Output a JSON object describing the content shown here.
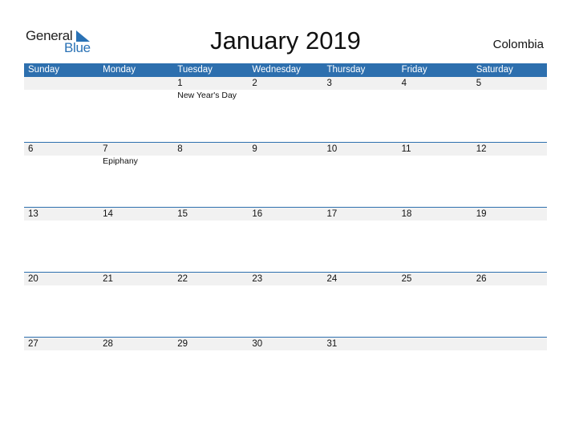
{
  "logo": {
    "line1": "General",
    "line2": "Blue"
  },
  "title": "January 2019",
  "country": "Colombia",
  "colors": {
    "header_bg": "#2d6fae",
    "logo_blue": "#2a72b5",
    "band": "#f1f1f1"
  },
  "days": [
    "Sunday",
    "Monday",
    "Tuesday",
    "Wednesday",
    "Thursday",
    "Friday",
    "Saturday"
  ],
  "weeks": [
    [
      {
        "d": "",
        "h": ""
      },
      {
        "d": "",
        "h": ""
      },
      {
        "d": "1",
        "h": "New Year's Day"
      },
      {
        "d": "2",
        "h": ""
      },
      {
        "d": "3",
        "h": ""
      },
      {
        "d": "4",
        "h": ""
      },
      {
        "d": "5",
        "h": ""
      }
    ],
    [
      {
        "d": "6",
        "h": ""
      },
      {
        "d": "7",
        "h": "Epiphany"
      },
      {
        "d": "8",
        "h": ""
      },
      {
        "d": "9",
        "h": ""
      },
      {
        "d": "10",
        "h": ""
      },
      {
        "d": "11",
        "h": ""
      },
      {
        "d": "12",
        "h": ""
      }
    ],
    [
      {
        "d": "13",
        "h": ""
      },
      {
        "d": "14",
        "h": ""
      },
      {
        "d": "15",
        "h": ""
      },
      {
        "d": "16",
        "h": ""
      },
      {
        "d": "17",
        "h": ""
      },
      {
        "d": "18",
        "h": ""
      },
      {
        "d": "19",
        "h": ""
      }
    ],
    [
      {
        "d": "20",
        "h": ""
      },
      {
        "d": "21",
        "h": ""
      },
      {
        "d": "22",
        "h": ""
      },
      {
        "d": "23",
        "h": ""
      },
      {
        "d": "24",
        "h": ""
      },
      {
        "d": "25",
        "h": ""
      },
      {
        "d": "26",
        "h": ""
      }
    ],
    [
      {
        "d": "27",
        "h": ""
      },
      {
        "d": "28",
        "h": ""
      },
      {
        "d": "29",
        "h": ""
      },
      {
        "d": "30",
        "h": ""
      },
      {
        "d": "31",
        "h": ""
      },
      {
        "d": "",
        "h": ""
      },
      {
        "d": "",
        "h": ""
      }
    ]
  ]
}
